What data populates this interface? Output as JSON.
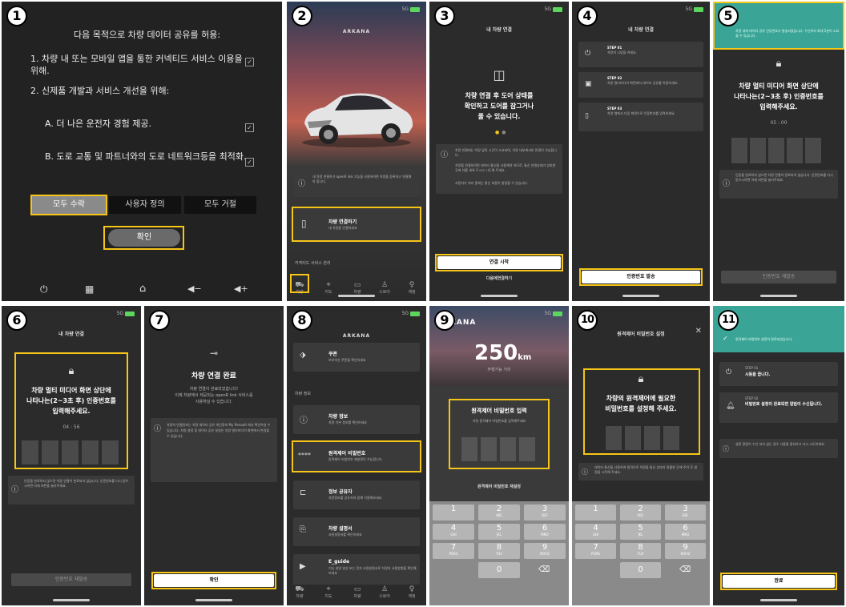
{
  "panel_numbers": [
    "1",
    "2",
    "3",
    "4",
    "5",
    "6",
    "7",
    "8",
    "9",
    "10",
    "11"
  ],
  "p1": {
    "heading": "다음 목적으로 차량 데이터 공유를 허용:",
    "item1_line1": "1. 차량 내 또는 모바일 앱을 통한 커넥티드 서비스 이용을",
    "item1_line2": "위해.",
    "item2": "2. 신제품 개발과 서비스 개선을 위해:",
    "itemA": "A. 더 나은 운전자 경험 제공.",
    "itemB": "B. 도로 교통 및 파트너와의 도로 네트워크등을 최적화.",
    "btn_accept": "모두 수락",
    "btn_custom": "사용자 정의",
    "btn_reject": "모두 거절",
    "btn_confirm": "확인",
    "check": "✓"
  },
  "p2": {
    "brand": "ARKANA",
    "info_text": "내 차량 연결하기 openR link 기능을 사용하려면 차량을 등록하고 연결해야 합니다.",
    "connect_title": "차량 연결하기",
    "connect_sub": "내 차량을 연결하세요",
    "section": "커넥티드 서비스 관리",
    "tabs": [
      "차량",
      "지도",
      "차량",
      "스토어",
      "계정"
    ]
  },
  "p3": {
    "title": "내 차량 연결",
    "big1": "차량 연결 후 도어 상태를",
    "big2": "확인하고 도어를 잠그거나",
    "big3": "풀 수 있습니다.",
    "info1": "차량 연결에는 차량 앞뒤 시간이 소요되며, 차량 내부에서만 연결이 가능합니다.",
    "info2": "차량을 연결하려면 데이터 통신을 사용해야 하므로, 통신 연결상태가 양호한 곳에 차를 세워 두시고 시도해 주세요.",
    "info3": "사용자가 처리 중에는 통신 비용이 발생할 수 있습니다.",
    "btn_start": "연결 시작",
    "btn_later": "다음에연결하기"
  },
  "p4": {
    "title": "내 차량 연결",
    "step1": "STEP 01",
    "step1_t": "차량의 시동을 켜세요.",
    "step2": "STEP 02",
    "step2_t": "차량 멀티미디어 화면에서 데이터 공유를 허용하세요.",
    "step3": "STEP 03",
    "step3_t": "차량 앱에서 다음 화면으로 인증번호를 입력하세요.",
    "btn": "인증번호 발송"
  },
  "p5": {
    "banner": "차량 내에 데이터 공유 인증번호가 발송되었습니다. 수신까지 최대 5분이 소요될 수 있습니다.",
    "big1": "차량 멀티 미디어 화면 상단에",
    "big2": "나타나는(2~3초 후) 인증번호를",
    "big3": "입력해주세요.",
    "timer": "05 : 00",
    "info": "인증을 완료하지 않으면 차량 연결이 완료되지 않습니다. 인증번호를 다시 받으시려면 아래 버튼을 눌러주세요.",
    "btn": "인증번호 재발송"
  },
  "p6": {
    "title": "내 차량 연결",
    "big1": "차량 멀티 미디어 화면 상단에",
    "big2": "나타나는(2~3초 후) 인증번호를",
    "big3": "입력해주세요.",
    "timer": "04 : 56",
    "info": "인증을 완료하지 않으면 차량 연결이 완료되지 않습니다. 인증번호를 다시 받으시려면 아래 버튼을 눌러주세요.",
    "btn": "인증번호 재발송"
  },
  "p7": {
    "big": "차량 연결 완료",
    "sub1": "차량 연결이 완료되었습니다!",
    "sub2": "이제 차량에서 제공되는 openR link 서비스를",
    "sub3": "사용하실 수 있습니다.",
    "info": "차량의 연결정보는 차량 데이터 공유 개인정보 My Renault 에서 확인하실 수 있습니다. 차량 설정 및 데이터 공유 설정은 차량 멀티미디어 화면에서 변경할 수 있습니다.",
    "btn": "확인"
  },
  "p8": {
    "brand": "ARKANA",
    "coupon": "쿠폰",
    "coupon_sub": "보유하신 쿠폰을 확인하세요",
    "section": "차량 정보",
    "info": "차량 정보",
    "info_sub": "차량 기본 정보를 확인하세요",
    "pw": "원격제어 비밀번호",
    "pw_sub": "원격제어 비밀번호 재설정이 가능합니다.",
    "share": "정보 공유자",
    "share_sub": "차량정보를 공유자와 함께 이용해보세요",
    "manual": "차량 설명서",
    "manual_sub": "사용설명서를 확인하세요",
    "eguide": "E_guide",
    "eguide_sub": "기능 설명 영상 보는 전자 사용설명서로 차량의 사용방법을 확인해보세요",
    "tabs": [
      "차량",
      "지도",
      "차량",
      "스토어",
      "계정"
    ]
  },
  "p9": {
    "brand": "ARKANA",
    "range": "250",
    "unit": "km",
    "range_label": "주행가능 거리",
    "dlg_title": "원격제어 비밀번호 입력",
    "dlg_sub": "차량 원격제어 비밀번호를 입력해주세요",
    "reset": "원격제어 비밀번호 재설정"
  },
  "p10": {
    "title": "원격제어 비밀번호 설정",
    "big1": "차량의 원격제어에 필요한",
    "big2": "비밀번호를 설정해 주세요.",
    "info": "데이터 통신을 사용하여 원격으로 차량을 통신 상태가 원활한 곳에 주차 후 설정을 시작해 주세요."
  },
  "p11": {
    "banner": "원격제어 비밀번호 설정이 완료되었습니다.",
    "step1": "STEP 01",
    "step1_t": "시동을 끕니다.",
    "step2": "STEP 02",
    "step2_t": "비밀번호 설정이 완료되면 알림이 수신됩니다.",
    "info": "설정 알림이 수신 되지 않는 경우 사용을 중지하고 다시 시도하세요.",
    "btn": "완료"
  },
  "keypad": [
    {
      "d": "1",
      "l": ""
    },
    {
      "d": "2",
      "l": "ABC"
    },
    {
      "d": "3",
      "l": "DEF"
    },
    {
      "d": "4",
      "l": "GHI"
    },
    {
      "d": "5",
      "l": "JKL"
    },
    {
      "d": "6",
      "l": "MNO"
    },
    {
      "d": "7",
      "l": "PQRS"
    },
    {
      "d": "8",
      "l": "TUV"
    },
    {
      "d": "9",
      "l": "WXYZ"
    },
    {
      "d": "0",
      "l": ""
    }
  ],
  "status": "5G"
}
